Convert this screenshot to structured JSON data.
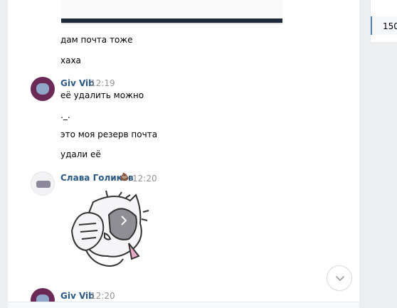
{
  "messages": {
    "m1": "дам почта тоже",
    "m2": "хаха",
    "m3": "её удалить можно",
    "m4": "._.",
    "m5": "это моя резерв почта",
    "m6": "удали её"
  },
  "authors": {
    "giv": {
      "name": "Giv Vib",
      "time": "12:19"
    },
    "slava": {
      "name": "Слава Голиков",
      "time": "12:20",
      "emoji": "💩"
    },
    "giv2": {
      "name": "Giv Vib",
      "time": "12:20"
    }
  },
  "right_panel": {
    "count": "150"
  },
  "icons": {
    "scroll_down": "chevron-down-icon",
    "sticker": "cat-facepalm-sticker"
  },
  "colors": {
    "author_link": "#2a5885",
    "time_gray": "#939393",
    "background": "#edeef0"
  }
}
